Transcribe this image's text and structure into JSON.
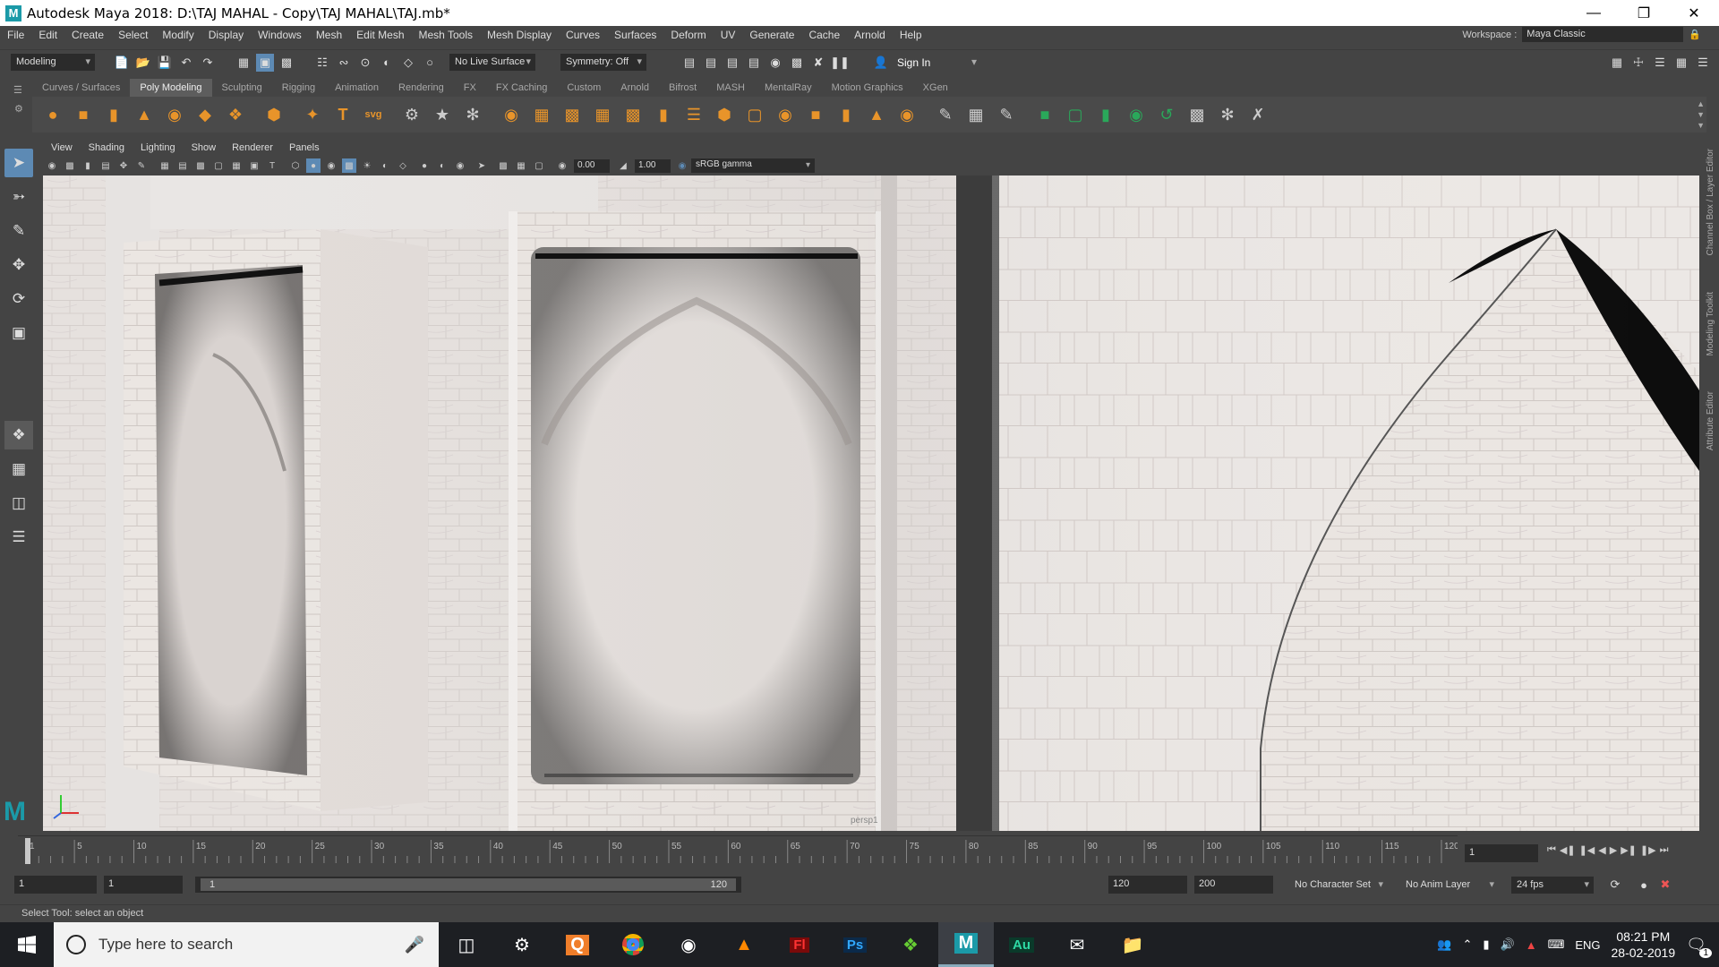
{
  "window": {
    "title": "Autodesk Maya 2018: D:\\TAJ MAHAL - Copy\\TAJ MAHAL\\TAJ.mb*",
    "logo_letter": "M"
  },
  "menubar": [
    "File",
    "Edit",
    "Create",
    "Select",
    "Modify",
    "Display",
    "Windows",
    "Mesh",
    "Edit Mesh",
    "Mesh Tools",
    "Mesh Display",
    "Curves",
    "Surfaces",
    "Deform",
    "UV",
    "Generate",
    "Cache",
    "Arnold",
    "Help"
  ],
  "workspace": {
    "label": "Workspace :",
    "value": "Maya Classic"
  },
  "statusline": {
    "mode": "Modeling",
    "live_surface": "No Live Surface",
    "symmetry": "Symmetry: Off",
    "sign_in": "Sign In"
  },
  "shelf_tabs": [
    "Curves / Surfaces",
    "Poly Modeling",
    "Sculpting",
    "Rigging",
    "Animation",
    "Rendering",
    "FX",
    "FX Caching",
    "Custom",
    "Arnold",
    "Bifrost",
    "MASH",
    "MentalRay",
    "Motion Graphics",
    "XGen"
  ],
  "shelf_active": "Poly Modeling",
  "panel_menu": [
    "View",
    "Shading",
    "Lighting",
    "Show",
    "Renderer",
    "Panels"
  ],
  "panel_tools": {
    "exposure": "0.00",
    "gamma": "1.00",
    "color_space": "sRGB gamma"
  },
  "viewport": {
    "camera_label": "persp1"
  },
  "right_tabs": [
    "Channel Box / Layer Editor",
    "Modeling Toolkit",
    "Attribute Editor"
  ],
  "timeline": {
    "ticks": [
      1,
      5,
      10,
      15,
      20,
      25,
      30,
      35,
      40,
      45,
      50,
      55,
      60,
      65,
      70,
      75,
      80,
      85,
      90,
      95,
      100,
      105,
      110,
      115,
      120
    ],
    "current_frame": "1",
    "range": [
      1,
      120
    ]
  },
  "range_bar": {
    "start": "1",
    "playback_start": "1",
    "slider_start": "1",
    "slider_end": "120",
    "playback_end": "120",
    "end": "200",
    "character_set": "No Character Set",
    "anim_layer": "No Anim Layer",
    "fps": "24 fps"
  },
  "help_line": "Select Tool: select an object",
  "taskbar": {
    "search_placeholder": "Type here to search",
    "apps": [
      "task-view",
      "settings",
      "qbittorrent",
      "chrome",
      "media-player",
      "vlc",
      "flash",
      "photoshop",
      "corel",
      "maya",
      "audition",
      "mail",
      "file-explorer"
    ],
    "language": "ENG",
    "time": "08:21 PM",
    "date": "28-02-2019",
    "notification_count": "1"
  },
  "colors": {
    "accent": "#5d8ab4",
    "shelf_bg": "#4a4a4a",
    "ui_bg": "#444444",
    "field_bg": "#2b2b2b",
    "maya_teal": "#1b9aa8"
  }
}
